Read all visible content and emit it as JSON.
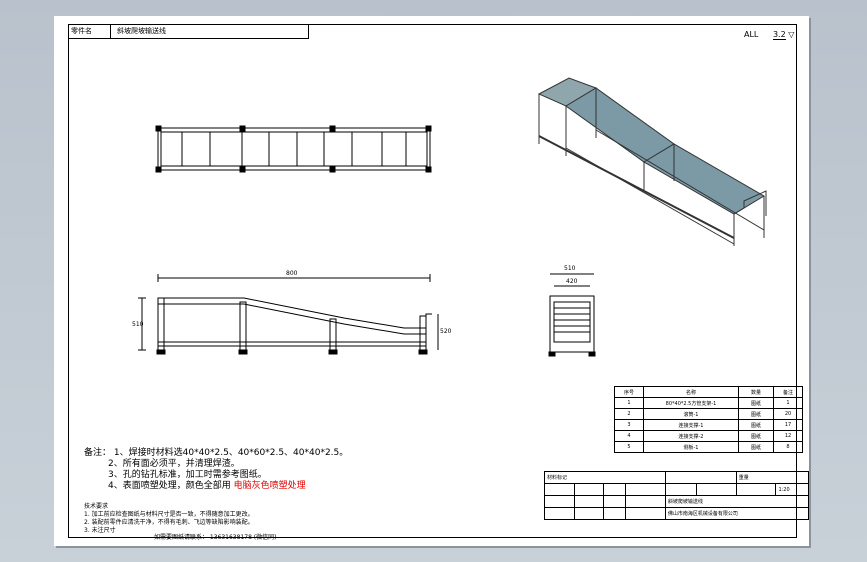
{
  "title_block": {
    "label": "零件名",
    "value": "斜坡爬坡输送线"
  },
  "roughness": {
    "prefix": "ALL",
    "value": "3.2"
  },
  "dims": {
    "length": "800",
    "height": "510",
    "height2": "520",
    "width": "510",
    "inner": "420"
  },
  "notes": {
    "heading": "备注：",
    "lines": [
      "1、焊接时材料选40*40*2.5、40*60*2.5、40*40*2.5。",
      "2、所有面必须平，并清理焊渣。",
      "3、孔的钻孔标准，加工时需参考图纸。",
      "4、表面喷塑处理，颜色全部用"
    ],
    "red": "电脑灰色喷塑处理"
  },
  "tech_notes": {
    "heading": "技术要求",
    "lines": [
      "1. 加工前应检查图纸与材料尺寸是否一致，不得随意加工更改。",
      "2. 装配前零件应清洗干净，不得有毛刺、飞边等缺陷影响装配。",
      "3. 未注尺寸"
    ]
  },
  "contact": "如需要图纸请联系：   13631638178  (微信同)",
  "bom": {
    "header": [
      "序号",
      "名称",
      "数量",
      "备注"
    ],
    "rows": [
      [
        "1",
        "80*40*2.5方管支架-1",
        "1",
        "图纸"
      ],
      [
        "2",
        "滚筒-1",
        "20",
        "图纸"
      ],
      [
        "3",
        "连接支撑-1",
        "17",
        "图纸"
      ],
      [
        "4",
        "连接支撑-2",
        "12",
        "图纸"
      ],
      [
        "5",
        "侧板-1",
        "8",
        "图纸"
      ]
    ]
  },
  "title_table": {
    "material_label": "材料标记",
    "weight": "重量",
    "scale": "1:20",
    "name": "斜坡爬坡输送线",
    "company": "佛山市南海区机械设备有限公司"
  }
}
